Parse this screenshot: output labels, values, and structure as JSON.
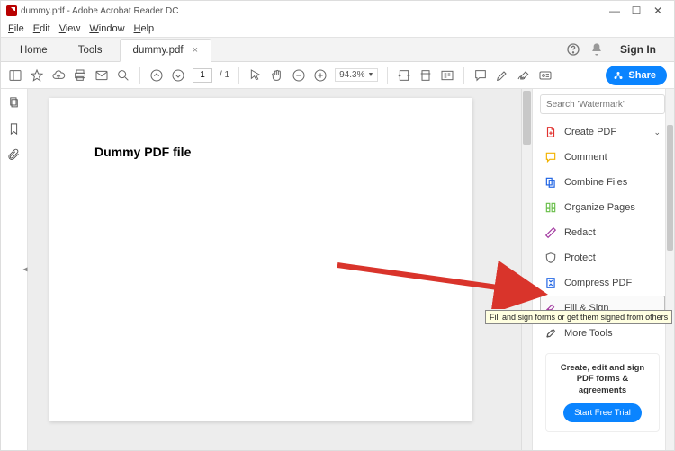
{
  "titlebar": {
    "text": "dummy.pdf - Adobe Acrobat Reader DC"
  },
  "menus": {
    "file": "File",
    "edit": "Edit",
    "view": "View",
    "window": "Window",
    "help": "Help"
  },
  "tabs": {
    "home": "Home",
    "tools": "Tools",
    "doc": "dummy.pdf"
  },
  "header": {
    "signin": "Sign In"
  },
  "toolbar": {
    "page_current": "1",
    "page_total": "/ 1",
    "zoom": "94.3%",
    "share": "Share"
  },
  "document": {
    "heading": "Dummy PDF file"
  },
  "right": {
    "search_placeholder": "Search 'Watermark'",
    "tools": [
      {
        "label": "Create PDF",
        "color": "#e1322f",
        "chev": true
      },
      {
        "label": "Comment",
        "color": "#f2b200"
      },
      {
        "label": "Combine Files",
        "color": "#1c62e3"
      },
      {
        "label": "Organize Pages",
        "color": "#6abf4b"
      },
      {
        "label": "Redact",
        "color": "#a239a0"
      },
      {
        "label": "Protect",
        "color": "#6c6c6c"
      },
      {
        "label": "Compress PDF",
        "color": "#1c62e3"
      },
      {
        "label": "Fill & Sign",
        "color": "#a239a0",
        "selected": true
      },
      {
        "label": "More Tools",
        "color": "#555"
      }
    ],
    "tooltip": "Fill and sign forms or get them signed from others",
    "promo": {
      "text": "Create, edit and sign PDF forms & agreements",
      "cta": "Start Free Trial"
    }
  }
}
